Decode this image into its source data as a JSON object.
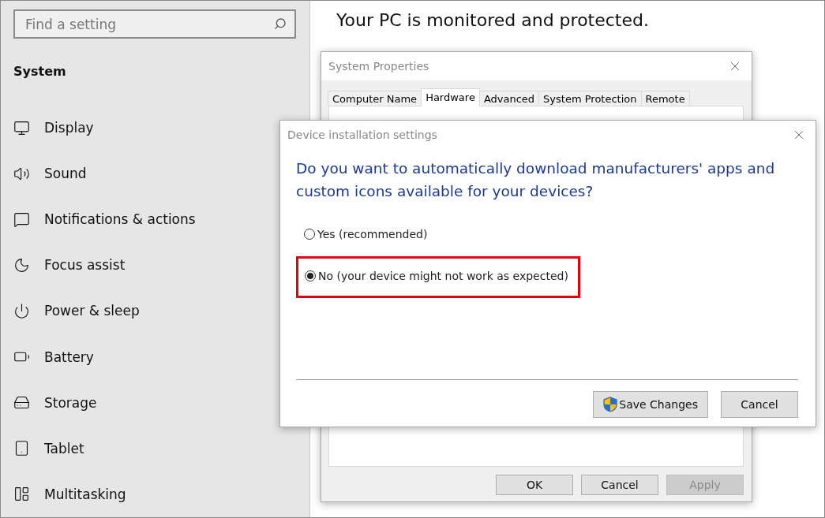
{
  "search": {
    "placeholder": "Find a setting"
  },
  "sidebar": {
    "heading": "System",
    "items": [
      {
        "label": "Display"
      },
      {
        "label": "Sound"
      },
      {
        "label": "Notifications & actions"
      },
      {
        "label": "Focus assist"
      },
      {
        "label": "Power & sleep"
      },
      {
        "label": "Battery"
      },
      {
        "label": "Storage"
      },
      {
        "label": "Tablet"
      },
      {
        "label": "Multitasking"
      }
    ]
  },
  "page": {
    "heading": "Your PC is monitored and protected."
  },
  "system_properties": {
    "title": "System Properties",
    "tabs": [
      {
        "label": "Computer Name",
        "selected": false
      },
      {
        "label": "Hardware",
        "selected": true
      },
      {
        "label": "Advanced",
        "selected": false
      },
      {
        "label": "System Protection",
        "selected": false
      },
      {
        "label": "Remote",
        "selected": false
      }
    ],
    "buttons": [
      {
        "label": "OK",
        "disabled": false
      },
      {
        "label": "Cancel",
        "disabled": false
      },
      {
        "label": "Apply",
        "disabled": true
      }
    ]
  },
  "device_dialog": {
    "title": "Device installation settings",
    "question": "Do you want to automatically download manufacturers' apps and custom icons available for your devices?",
    "options": [
      {
        "label": "Yes (recommended)",
        "selected": false,
        "highlighted": false
      },
      {
        "label": "No (your device might not work as expected)",
        "selected": true,
        "highlighted": true
      }
    ],
    "buttons": [
      {
        "label": "Save Changes",
        "kind": "shield"
      },
      {
        "label": "Cancel",
        "kind": "plain"
      }
    ]
  }
}
